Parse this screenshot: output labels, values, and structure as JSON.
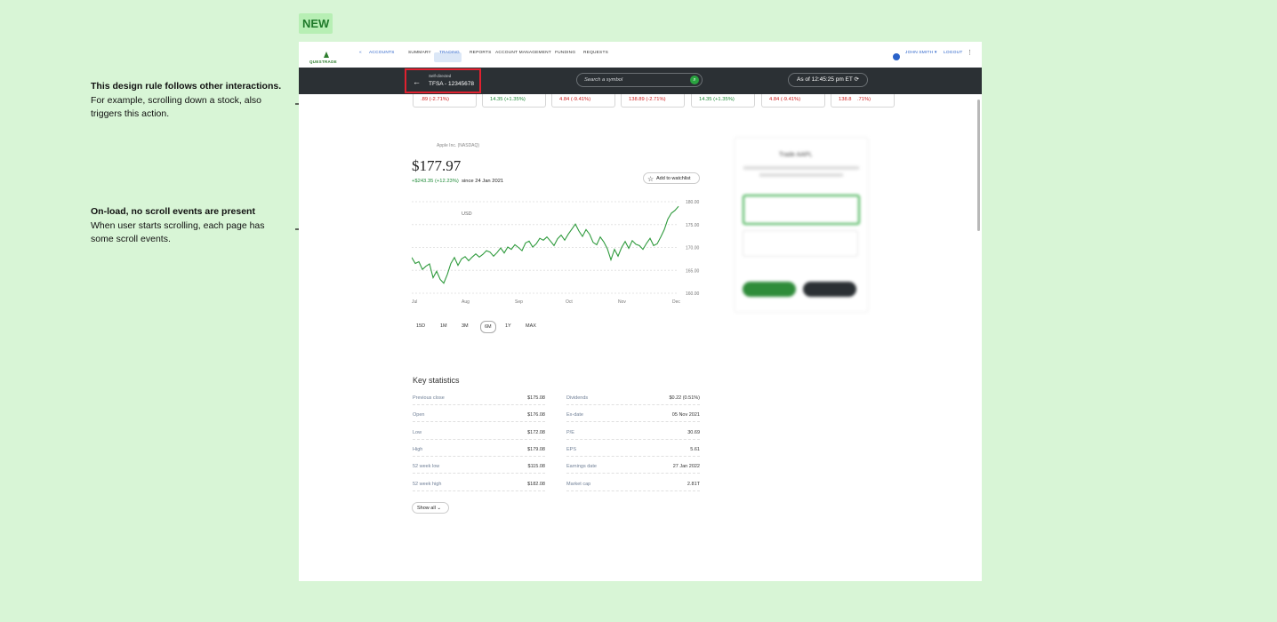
{
  "badge": "NEW",
  "notes": [
    {
      "title": "This design rule follows other interactions.",
      "body": "For example, scrolling down a stock, also triggers this action."
    },
    {
      "title": "On-load, no scroll events are present",
      "body": "When user starts scrolling, each page has some scroll events."
    }
  ],
  "nav": {
    "logo": "QUESTRADE",
    "accounts": "ACCOUNTS",
    "items": [
      "SUMMARY",
      "TRADING",
      "REPORTS",
      "ACCOUNT MANAGEMENT",
      "FUNDING",
      "REQUESTS"
    ],
    "user": "JOHN SMITH",
    "logout": "LOGOUT"
  },
  "account": {
    "sub": "Self-directed",
    "main": "TFSA - 12345678"
  },
  "search": {
    "placeholder": "Search a symbol"
  },
  "as_of": "As of 12:45:25 pm ET",
  "tickers": [
    {
      "text": ".89  (-2.71%)",
      "color": "red"
    },
    {
      "text": "14.35  (+1.35%)",
      "color": "green"
    },
    {
      "text": "4.84  (-9.41%)",
      "color": "red"
    },
    {
      "text": "138.89  (-2.71%)",
      "color": "red"
    },
    {
      "text": "14.35  (+1.35%)",
      "color": "green"
    },
    {
      "text": "4.84  (-9.41%)",
      "color": "red"
    },
    {
      "text": "138.8    .71%)",
      "color": "red"
    }
  ],
  "stock": {
    "name": "Apple Inc. (NASDAQ)",
    "price": "$177.97",
    "change": "+$243.35 (+12.23%)",
    "since": "since 24 Jan 2021",
    "watchlist": "Add to watchlist"
  },
  "chart_data": {
    "type": "line",
    "currency_label": "USD",
    "x_ticks": [
      "Jul",
      "Aug",
      "Sep",
      "Oct",
      "Nov",
      "Dec"
    ],
    "y_ticks": [
      "180.00",
      "175.00",
      "170.00",
      "165.00",
      "160.00"
    ],
    "ylim": [
      160,
      180
    ],
    "values": [
      167.8,
      166.5,
      166.9,
      165.2,
      165.9,
      166.4,
      163.4,
      164.8,
      163.0,
      162.2,
      164.1,
      166.5,
      167.8,
      166.1,
      167.5,
      168.0,
      167.1,
      167.9,
      168.6,
      167.9,
      168.5,
      169.3,
      169.0,
      168.1,
      168.9,
      169.9,
      168.8,
      170.1,
      169.6,
      170.6,
      170.0,
      169.3,
      171.0,
      171.4,
      170.1,
      170.8,
      172.0,
      171.6,
      172.3,
      171.4,
      170.4,
      171.9,
      172.7,
      171.6,
      172.9,
      174.0,
      175.1,
      173.6,
      172.4,
      173.9,
      172.9,
      171.1,
      170.6,
      172.3,
      171.2,
      169.7,
      167.3,
      169.6,
      168.1,
      170.0,
      171.3,
      169.8,
      171.5,
      170.7,
      170.4,
      169.6,
      170.9,
      172.0,
      170.4,
      170.8,
      172.3,
      173.9,
      176.2,
      177.5,
      178.1,
      179.0
    ],
    "grid": true
  },
  "ranges": [
    "15D",
    "1M",
    "3M",
    "6M",
    "1Y",
    "MAX"
  ],
  "selected_range": "6M",
  "stats": {
    "title": "Key statistics",
    "left": [
      {
        "label": "Previous close",
        "value": "$175.08"
      },
      {
        "label": "Open",
        "value": "$176.08"
      },
      {
        "label": "Low",
        "value": "$172.08"
      },
      {
        "label": "High",
        "value": "$179.08"
      },
      {
        "label": "52 week low",
        "value": "$115.08"
      },
      {
        "label": "52 week high",
        "value": "$182.08"
      }
    ],
    "right": [
      {
        "label": "Dividends",
        "value": "$0.22 (0.51%)"
      },
      {
        "label": "Ex-date",
        "value": "05 Nov 2021"
      },
      {
        "label": "P/E",
        "value": "30.69"
      },
      {
        "label": "EPS",
        "value": "5.61"
      },
      {
        "label": "Earnings date",
        "value": "27 Jan 2022"
      },
      {
        "label": "Market cap",
        "value": "2.81T"
      }
    ],
    "show_all": "Show all"
  },
  "trade_panel": {
    "title": "Trade AAPL"
  },
  "colors": {
    "accent_green": "#2aa340",
    "dark_bar": "#2b3034",
    "highlight": "#e0212f"
  }
}
